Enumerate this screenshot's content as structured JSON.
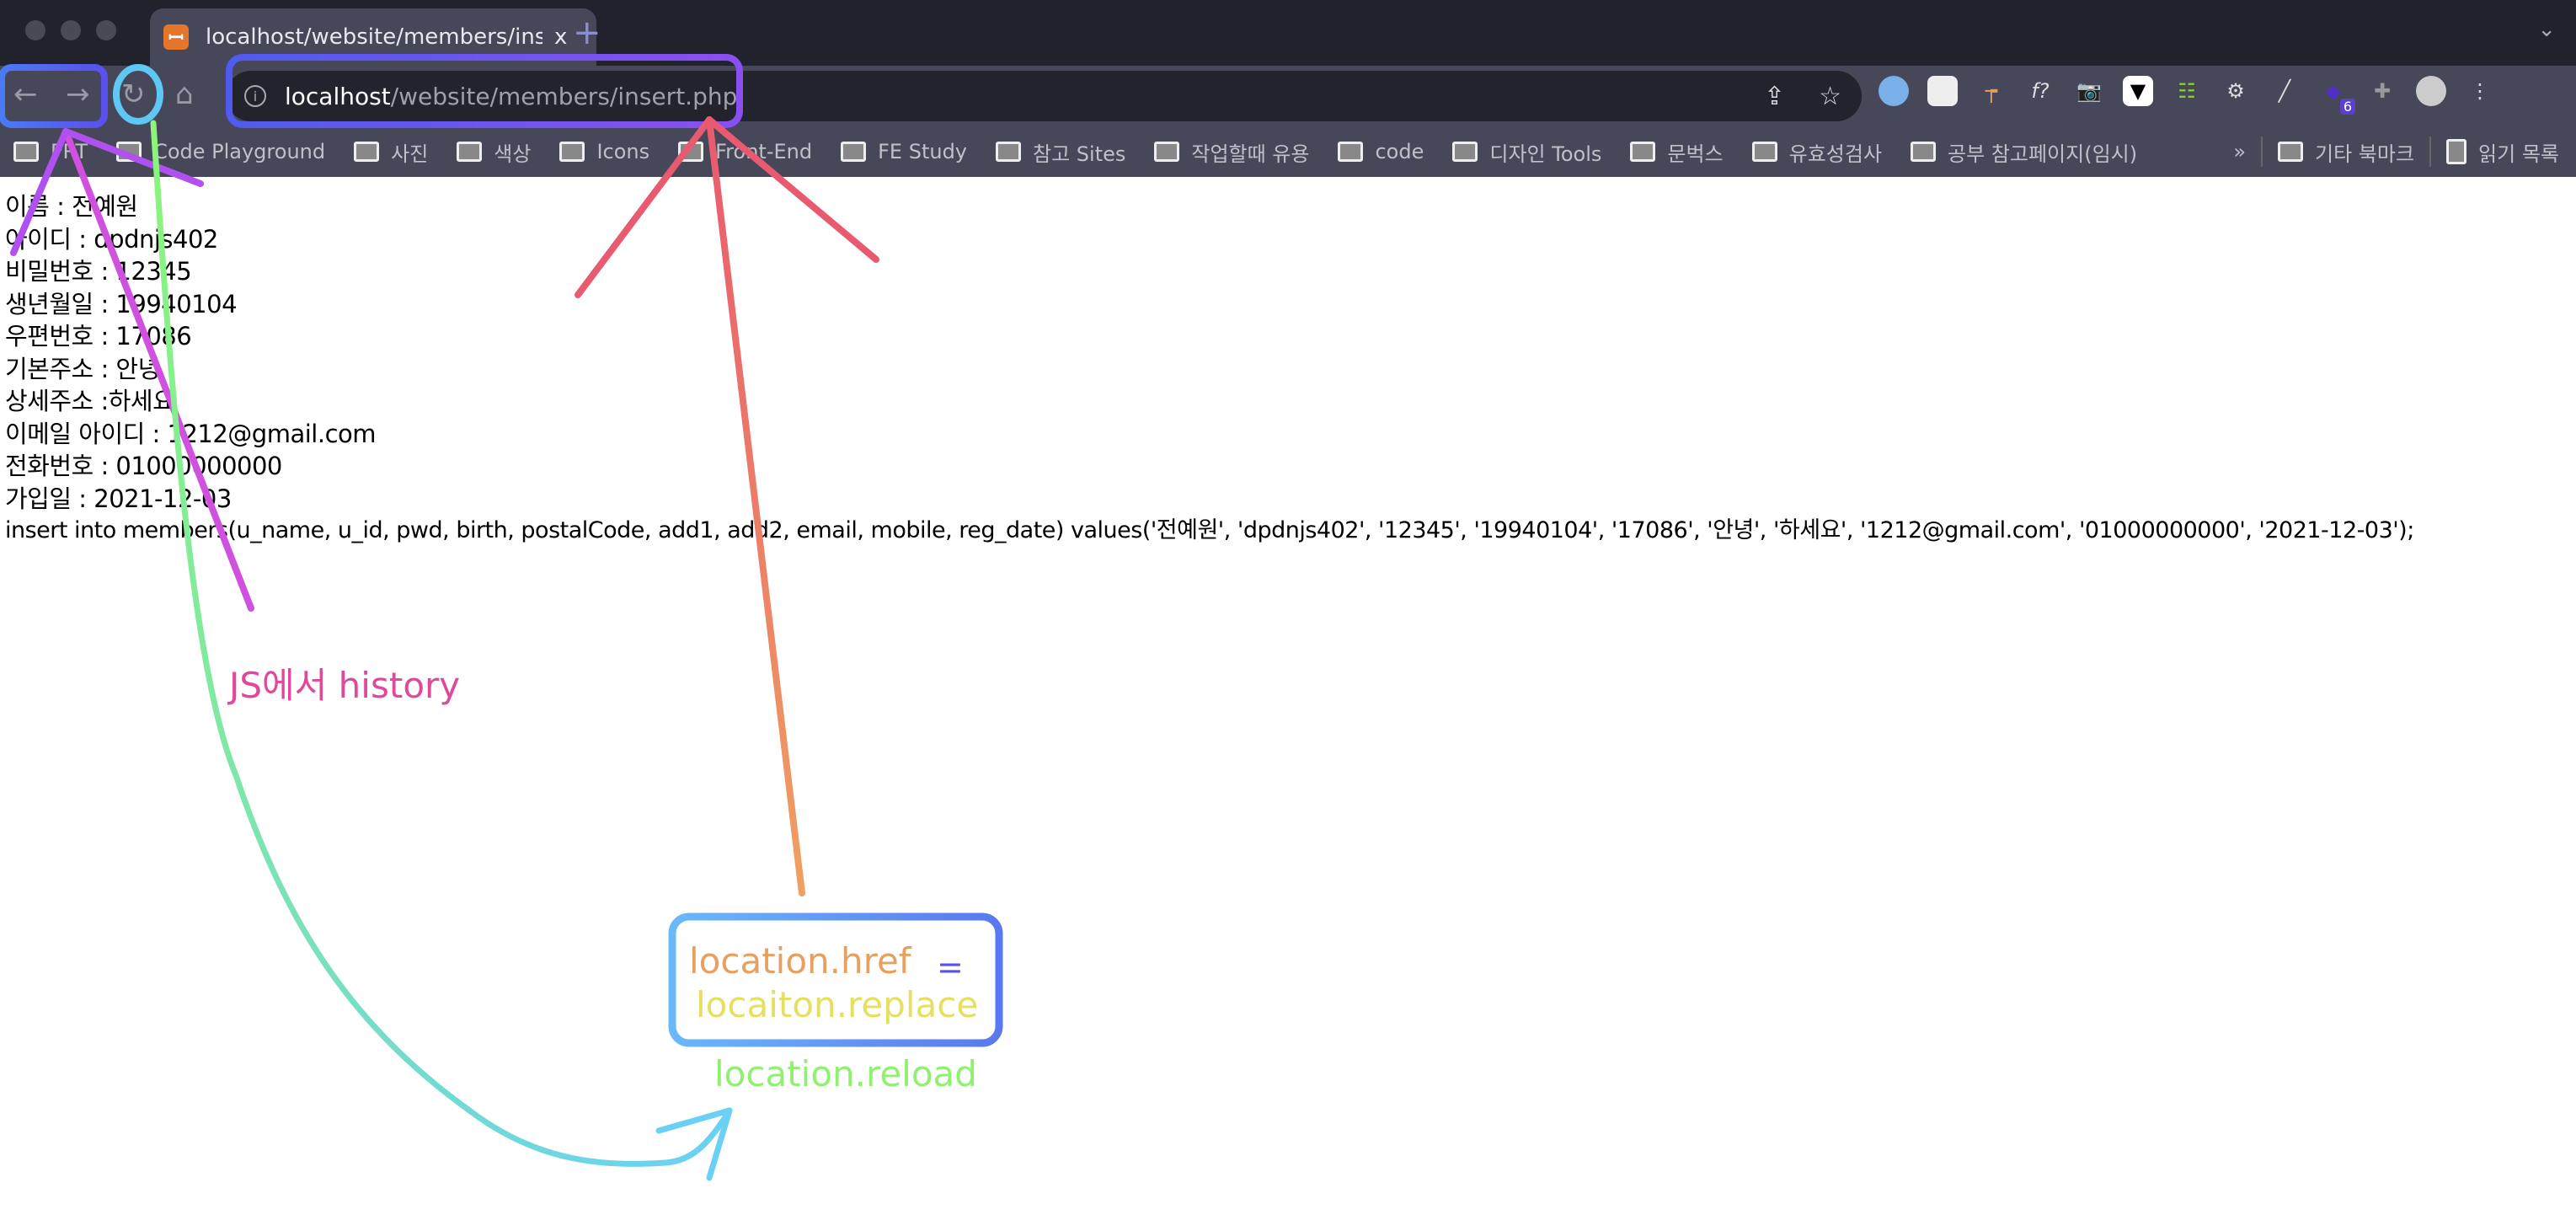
{
  "browser": {
    "tab_title": "localhost/website/members/insert.php",
    "tab_close": "x",
    "new_tab": "+",
    "url_host": "localhost",
    "url_path": "/website/members/insert.php",
    "extension_badge": "6",
    "bookmarks": [
      "PRT",
      "Code Playground",
      "사진",
      "색상",
      "Icons",
      "Front-End",
      "FE Study",
      "참고 Sites",
      "작업할때 유용",
      "code",
      "디자인 Tools",
      "문벅스",
      "유효성검사",
      "공부 참고페이지(임시)"
    ],
    "bookmarks_overflow": "»",
    "other_bookmarks": "기타 북마크",
    "reading_list": "읽기 목록"
  },
  "content": {
    "lines": [
      "이름 : 전예원",
      "아이디 : dpdnjs402",
      "비밀번호 : 12345",
      "생년월일 : 19940104",
      "우편번호 : 17086",
      "기본주소 : 안녕",
      "상세주소 :하세요",
      "이메일 아이디 : 1212@gmail.com",
      "전화번호 : 01000000000",
      "가입일 : 2021-12-03",
      "insert into members(u_name, u_id, pwd, birth, postalCode, add1, add2, email, mobile, reg_date) values('전예원', 'dpdnjs402', '12345', '19940104', '17086', '안녕', '하세요', '1212@gmail.com', '01000000000', '2021-12-03');"
    ]
  },
  "annotations": {
    "history_label": "JS에서 history",
    "href": "location.href",
    "equals": "=",
    "replace": "locaiton.replace",
    "reload": "location.reload"
  },
  "colors": {
    "history": "#e0489a",
    "nav_box": "#4f5bf0",
    "reload_circle": "#5ec8f5",
    "omnibox_box": "#7a4ff0",
    "arrow_red": "#e85a70",
    "arrow_green": "#8af57a"
  }
}
